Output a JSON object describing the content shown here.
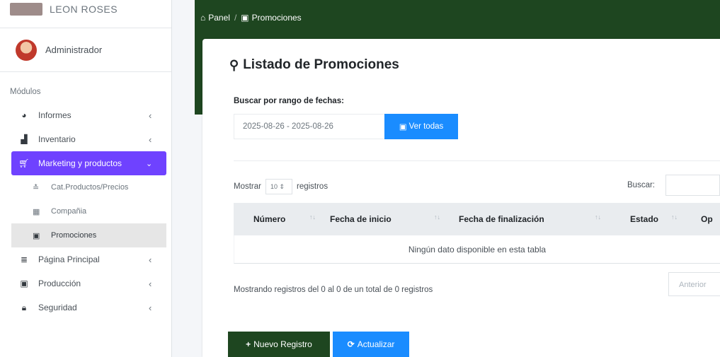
{
  "brand": {
    "name": "LEON ROSES"
  },
  "user": {
    "name": "Administrador"
  },
  "sidebar": {
    "header": "Módulos",
    "items": [
      {
        "label": "Informes",
        "icon": "pie-chart-icon"
      },
      {
        "label": "Inventario",
        "icon": "boxes-icon"
      },
      {
        "label": "Marketing y productos",
        "icon": "cart-icon"
      }
    ],
    "sub_items": [
      {
        "label": "Cat.Productos/Precios",
        "icon": "tag-icon"
      },
      {
        "label": "Compañia",
        "icon": "building-icon"
      },
      {
        "label": "Promociones",
        "icon": "calendar-icon"
      }
    ],
    "bottom_items": [
      {
        "label": "Página Principal",
        "icon": "list-icon"
      },
      {
        "label": "Producción",
        "icon": "calendar-icon"
      },
      {
        "label": "Seguridad",
        "icon": "lock-icon"
      }
    ]
  },
  "breadcrumb": {
    "home": "Panel",
    "current": "Promociones"
  },
  "card": {
    "title": "Listado de Promociones",
    "date_label": "Buscar por rango de fechas:",
    "date_value": "2025-08-26 - 2025-08-26",
    "ver_todas": "Ver todas"
  },
  "table": {
    "show_prefix": "Mostrar",
    "length_value": "10",
    "show_suffix": "registros",
    "search_label": "Buscar:",
    "columns": [
      "Número",
      "Fecha de inicio",
      "Fecha de finalización",
      "Estado",
      "Op"
    ],
    "empty": "Ningún dato disponible en esta tabla",
    "info": "Mostrando registros del 0 al 0 de un total de 0 registros",
    "prev": "Anterior"
  },
  "actions": {
    "new": "Nuevo Registro",
    "refresh": "Actualizar"
  },
  "colors": {
    "primary_green": "#1e4620",
    "accent_purple": "#6f42ff",
    "blue": "#1a8cff"
  }
}
